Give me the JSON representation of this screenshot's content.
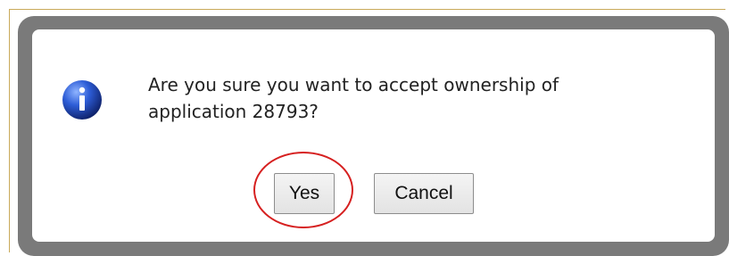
{
  "dialog": {
    "message_line_1": "Are you sure you want to accept ownership of",
    "message_line_2": "application 28793?",
    "icon": "info-icon",
    "buttons": {
      "yes": "Yes",
      "cancel": "Cancel"
    }
  },
  "colors": {
    "overlay_frame": "#7a7a7a",
    "dialog_bg": "#ffffff",
    "highlight": "#d62020",
    "info_icon": "#1f3f9c"
  }
}
